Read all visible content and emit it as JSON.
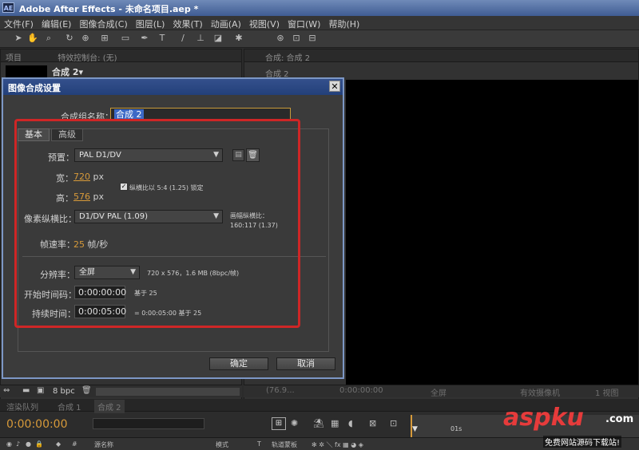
{
  "app": {
    "logo": "AE",
    "title": "Adobe After Effects - 未命名项目.aep *"
  },
  "menu": [
    "文件(F)",
    "编辑(E)",
    "图像合成(C)",
    "图层(L)",
    "效果(T)",
    "动画(A)",
    "视图(V)",
    "窗口(W)",
    "帮助(H)"
  ],
  "left_panel": {
    "tab_project": "项目",
    "tab_effects": "特效控制台: (无)",
    "item_name": "合成 2▾"
  },
  "comp_panel": {
    "tab": "合成: 合成 2",
    "breadcrumb": "合成 2"
  },
  "dialog": {
    "title": "图像合成设置",
    "close": "✕",
    "name_label": "合成组名称：",
    "name_value": "合成 2",
    "tabs": [
      "基本",
      "高级"
    ],
    "preset_label": "预置：",
    "preset_value": "PAL D1/DV",
    "width_label": "宽：",
    "width_value": "720",
    "width_unit": "px",
    "height_label": "高：",
    "height_value": "576",
    "height_unit": "px",
    "lock_label": "纵横比以 5:4 (1.25) 锁定",
    "par_label": "像素纵横比：",
    "par_value": "D1/DV PAL (1.09)",
    "frame_aspect_label": "画幅纵横比：",
    "frame_aspect_value": "160:117 (1.37)",
    "fps_label": "帧速率：",
    "fps_value": "25",
    "fps_unit": "帧/秒",
    "res_label": "分辨率：",
    "res_value": "全屏",
    "res_info": "720 x 576，1.6 MB (8bpc/帧)",
    "start_label": "开始时间码：",
    "start_value": "0:00:00:00",
    "start_base": "基于 25",
    "dur_label": "持续时间：",
    "dur_value": "0:00:05:00",
    "dur_info": "= 0:00:05:00  基于 25",
    "ok": "确定",
    "cancel": "取消"
  },
  "bottom_left": {
    "bpc": "8 bpc"
  },
  "viewer_bar": {
    "zoom": "(76.9...",
    "timecode": "0:00:00:00",
    "res": "全屏",
    "camera": "有效摄像机",
    "views": "1 视图"
  },
  "timeline": {
    "tabs": [
      "渲染队列",
      "合成 1",
      "合成 2"
    ],
    "timecode": "0:00:00:00",
    "col_num": "#",
    "col_name": "源名称",
    "col_mode": "模式",
    "col_t": "T",
    "col_trkmat": "轨道蒙板",
    "ruler_mark": "01s"
  },
  "watermark": {
    "main": "aspku",
    "domain": ".com",
    "sub": "免费网站源码下载站!"
  },
  "colors": {
    "highlight": "#cf2626",
    "accent_orange": "#d79a3a",
    "title_blue": "#34508c"
  }
}
